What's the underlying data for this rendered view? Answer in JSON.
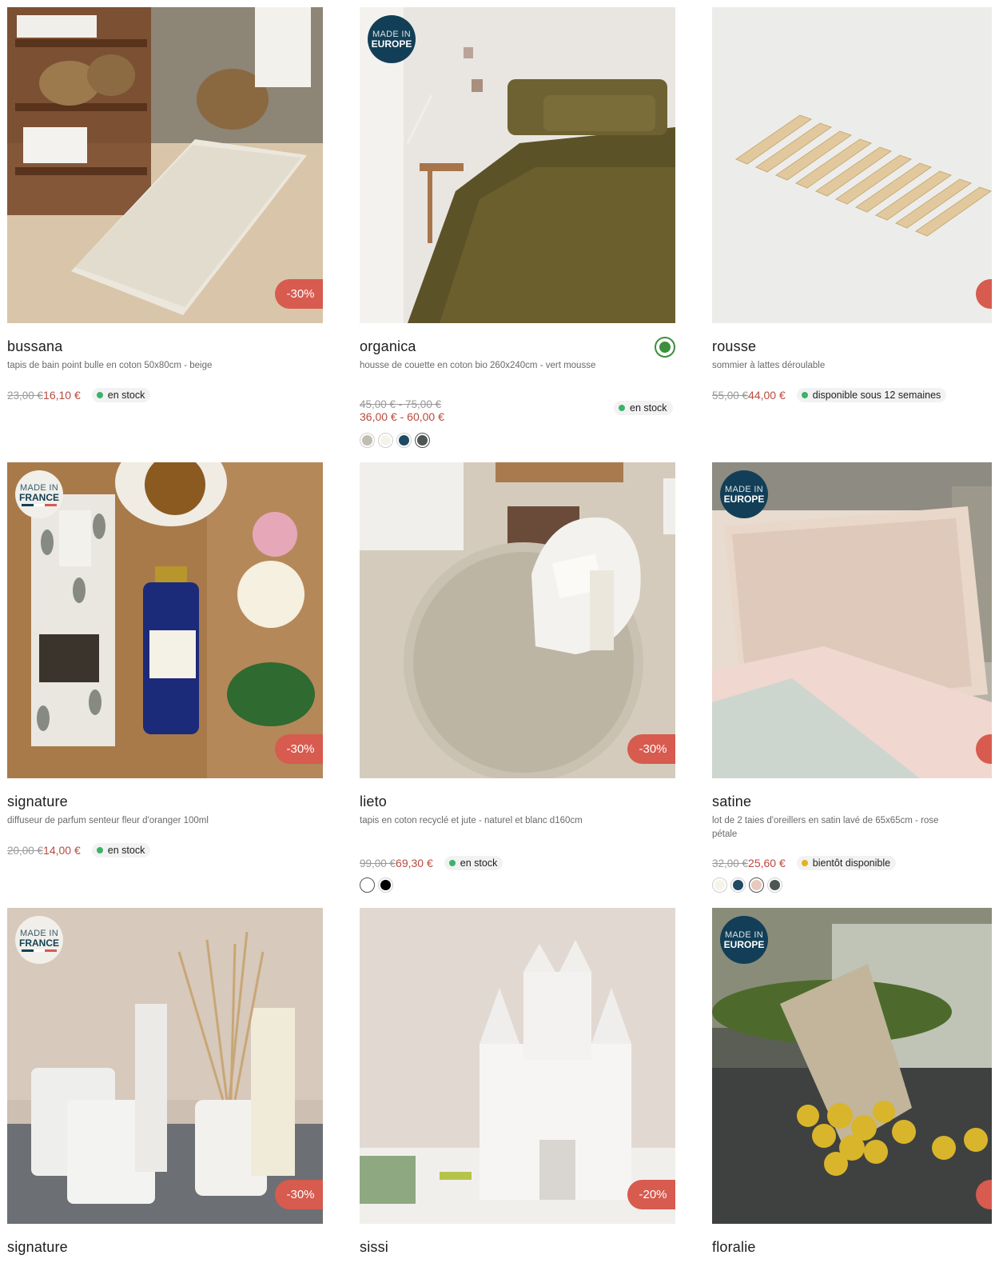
{
  "products": [
    {
      "name": "bussana",
      "desc": "tapis de bain point bulle en coton 50x80cm - beige",
      "old_price": "23,00 €",
      "new_price": "16,10 €",
      "stock": "en stock",
      "discount": "-30%"
    },
    {
      "name": "organica",
      "desc": "housse de couette en coton bio 260x240cm - vert mousse",
      "old_price": "45,00 € - 75,00 €",
      "new_price": "36,00 € - 60,00 €",
      "stock": "en stock",
      "badge_line1": "MADE IN",
      "badge_line2": "EUROPE",
      "bio_icon": "organic-cotton-icon",
      "swatches": [
        "#c2bdb1",
        "#f6f4ea",
        "#1e4a63",
        "#4e5652"
      ]
    },
    {
      "name": "rousse",
      "desc": "sommier à lattes déroulable",
      "old_price": "55,00 €",
      "new_price": "44,00 €",
      "stock": "disponible sous 12 semaines"
    },
    {
      "name": "signature",
      "desc": "diffuseur de parfum senteur fleur d'oranger 100ml",
      "old_price": "20,00 €",
      "new_price": "14,00 €",
      "stock": "en stock",
      "discount": "-30%",
      "badge_line1": "MADE IN",
      "badge_line2": "FRANCE"
    },
    {
      "name": "lieto",
      "desc": "tapis en coton recyclé et jute - naturel et blanc d160cm",
      "old_price": "99,00 €",
      "new_price": "69,30 €",
      "stock": "en stock",
      "discount": "-30%",
      "swatches": [
        "#ffffff",
        "#000000"
      ]
    },
    {
      "name": "satine",
      "desc": "lot de 2 taies d'oreillers en satin lavé de 65x65cm - rose pétale",
      "old_price": "32,00 €",
      "new_price": "25,60 €",
      "stock": "bientôt disponible",
      "badge_line1": "MADE IN",
      "badge_line2": "EUROPE",
      "swatches": [
        "#f6f4ea",
        "#1e4a63",
        "#e8c9bd",
        "#4e5652"
      ]
    },
    {
      "name": "signature",
      "discount": "-30%",
      "badge_line1": "MADE IN",
      "badge_line2": "FRANCE"
    },
    {
      "name": "sissi",
      "discount": "-20%"
    },
    {
      "name": "floralie",
      "badge_line1": "MADE IN",
      "badge_line2": "EUROPE"
    }
  ],
  "colors": {
    "discount": "#d75b4f",
    "sale_price": "#b84a3e",
    "in_stock": "#3bb36a",
    "soon": "#e3b31b",
    "badge_navy": "#123f57"
  }
}
